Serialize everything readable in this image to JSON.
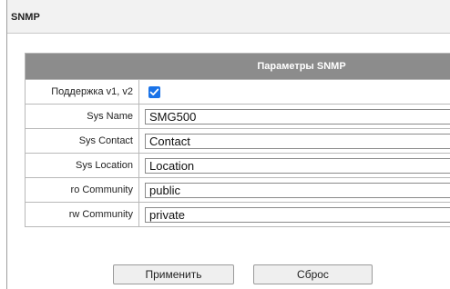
{
  "header": {
    "title": "SNMP"
  },
  "section": {
    "title": "Параметры SNMP"
  },
  "fields": {
    "support": {
      "label": "Поддержка v1, v2",
      "checked": true
    },
    "sys_name": {
      "label": "Sys Name",
      "value": "SMG500"
    },
    "sys_contact": {
      "label": "Sys Contact",
      "value": "Contact"
    },
    "sys_location": {
      "label": "Sys Location",
      "value": "Location"
    },
    "ro_community": {
      "label": "ro Community",
      "value": "public"
    },
    "rw_community": {
      "label": "rw Community",
      "value": "private"
    }
  },
  "actions": {
    "apply_label": "Применить",
    "reset_label": "Сброс"
  },
  "colors": {
    "section_header_bg": "#8c8c8c",
    "checkbox_accent": "#1a73e8"
  }
}
